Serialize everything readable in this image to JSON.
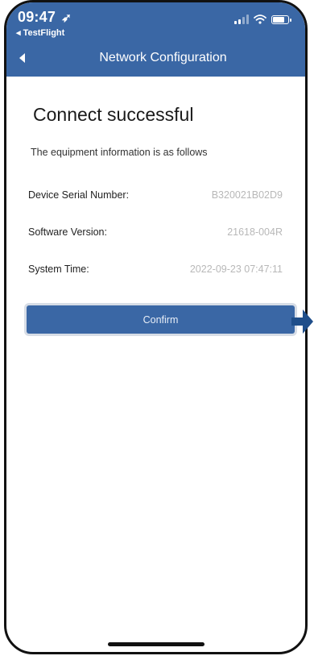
{
  "status_bar": {
    "time": "09:47",
    "location_icon": "location-arrow-icon",
    "back_app": "◂ TestFlight"
  },
  "nav": {
    "title": "Network Configuration",
    "back_icon": "back-arrow-icon"
  },
  "main": {
    "title": "Connect successful",
    "subtitle": "The equipment information is as follows",
    "rows": [
      {
        "label": "Device Serial Number:",
        "value": "B320021B02D9"
      },
      {
        "label": "Software Version:",
        "value": "21618-004R"
      },
      {
        "label": "System Time:",
        "value": "2022-09-23 07:47:11"
      }
    ],
    "confirm_label": "Confirm"
  },
  "colors": {
    "accent": "#3a67a5",
    "callout_arrow": "#1f4e8a"
  }
}
